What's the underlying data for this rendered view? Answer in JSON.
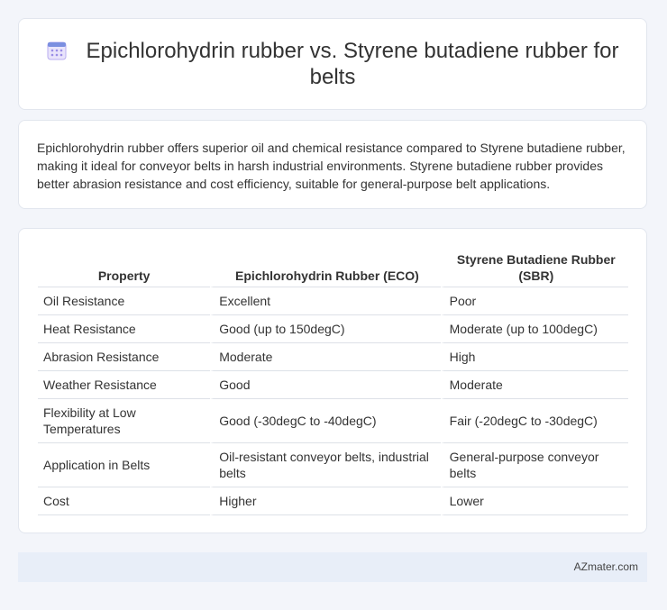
{
  "header": {
    "title": "Epichlorohydrin rubber vs. Styrene butadiene rubber for belts",
    "icon": "calendar-icon"
  },
  "description": "Epichlorohydrin rubber offers superior oil and chemical resistance compared to Styrene butadiene rubber, making it ideal for conveyor belts in harsh industrial environments. Styrene butadiene rubber provides better abrasion resistance and cost efficiency, suitable for general-purpose belt applications.",
  "table": {
    "headers": [
      "Property",
      "Epichlorohydrin Rubber (ECO)",
      "Styrene Butadiene Rubber (SBR)"
    ],
    "rows": [
      [
        "Oil Resistance",
        "Excellent",
        "Poor"
      ],
      [
        "Heat Resistance",
        "Good (up to 150degC)",
        "Moderate (up to 100degC)"
      ],
      [
        "Abrasion Resistance",
        "Moderate",
        "High"
      ],
      [
        "Weather Resistance",
        "Good",
        "Moderate"
      ],
      [
        "Flexibility at Low Temperatures",
        "Good (-30degC to -40degC)",
        "Fair (-20degC to -30degC)"
      ],
      [
        "Application in Belts",
        "Oil-resistant conveyor belts, industrial belts",
        "General-purpose conveyor belts"
      ],
      [
        "Cost",
        "Higher",
        "Lower"
      ]
    ]
  },
  "footer": {
    "brand": "AZmater.com"
  },
  "colors": {
    "background": "#f3f5fa",
    "card": "#ffffff",
    "footer": "#e8eef8",
    "icon_accent": "#7b8fe0"
  }
}
